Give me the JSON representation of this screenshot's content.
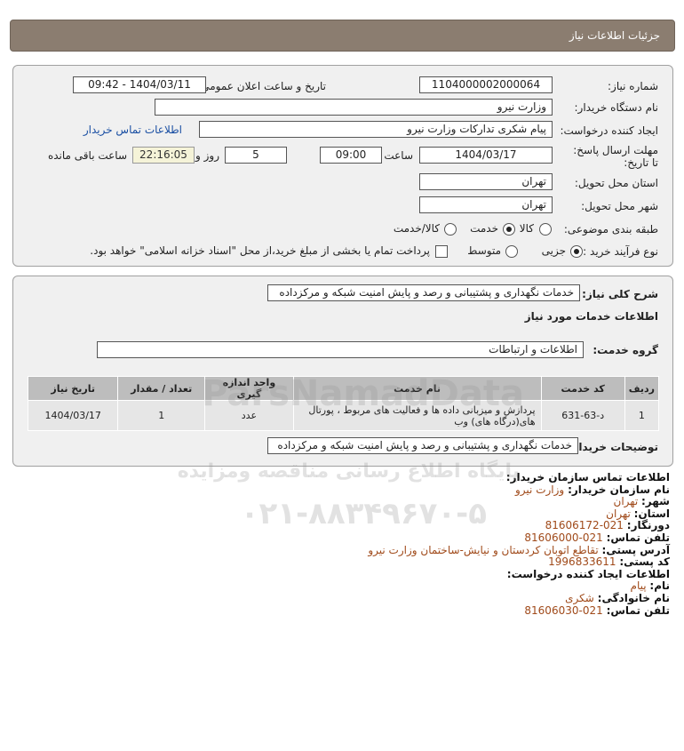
{
  "header": {
    "title": "جزئیات اطلاعات نیاز"
  },
  "form": {
    "need_number_label": "شماره نیاز:",
    "need_number": "1104000002000064",
    "announce_label": "تاریخ و ساعت اعلان عمومی:",
    "announce_value": "1404/03/11 - 09:42",
    "buyer_label": "نام دستگاه خریدار:",
    "buyer_value": "وزارت نیرو",
    "creator_label": "ایجاد کننده درخواست:",
    "creator_value": "پیام شکری تدارکات وزارت نیرو",
    "contact_link": "اطلاعات تماس خریدار",
    "deadline_label": "مهلت ارسال پاسخ: تا تاریخ:",
    "deadline_date": "1404/03/17",
    "hour_label": "ساعت",
    "deadline_hour": "09:00",
    "days_value": "5",
    "days_label": "روز و",
    "remaining_time": "22:16:05",
    "remaining_label": "ساعت باقی مانده",
    "province_label": "استان محل تحویل:",
    "province_value": "تهران",
    "city_label": "شهر محل تحویل:",
    "city_value": "تهران",
    "category_label": "طبقه بندی موضوعی:",
    "category_options": [
      "کالا",
      "خدمت",
      "کالا/خدمت"
    ],
    "category_selected": "خدمت",
    "process_label": "نوع فرآیند خرید :",
    "process_options": [
      "جزیی",
      "متوسط"
    ],
    "process_selected": "جزیی",
    "payment_note": "پرداخت تمام یا بخشی از مبلغ خرید،از محل \"اسناد خزانه اسلامی\" خواهد بود."
  },
  "need": {
    "summary_label": "شرح کلی نیاز:",
    "summary_value": "خدمات نگهداری و پشتیبانی و رصد و پایش امنیت شبکه و مرکزداده",
    "services_heading": "اطلاعات خدمات مورد نیاز",
    "group_label": "گروه خدمت:",
    "group_value": "اطلاعات و ارتباطات",
    "table": {
      "headers": [
        "ردیف",
        "کد خدمت",
        "نام خدمت",
        "واحد اندازه گیری",
        "تعداد / مقدار",
        "تاریخ نیاز"
      ],
      "rows": [
        [
          "1",
          "د-63-631",
          "پردازش و میزبانی داده ها و فعالیت های مربوط ، پورتال های(درگاه های) وب",
          "عدد",
          "1",
          "1404/03/17"
        ]
      ]
    },
    "description_label": "توضیحات خریدار:",
    "description_value": "خدمات نگهداری و پشتیبانی و رصد و پایش امنیت شبکه و مرکزداده"
  },
  "contact": {
    "heading": "اطلاعات تماس سازمان خریدار:",
    "org_label": "نام سازمان خریدار:",
    "org_value": "وزارت نیرو",
    "city_label": "شهر:",
    "city_value": "تهران",
    "province_label": "استان:",
    "province_value": "تهران",
    "fax_label": "دورنگار:",
    "fax_value": "021-81606172",
    "phone_label": "تلفن تماس:",
    "phone_value": "021-81606000",
    "address_label": "آدرس پستی:",
    "address_value": "تقاطع اتوبان کردستان و نیایش-ساختمان وزارت نیرو",
    "postal_label": "کد پستی:",
    "postal_value": "1996833611",
    "creator_heading": "اطلاعات ایجاد کننده درخواست:",
    "name_label": "نام:",
    "name_value": "پیام",
    "family_label": "نام خانوادگی:",
    "family_value": "شکری",
    "creator_phone_label": "تلفن تماس:",
    "creator_phone_value": "021-81606030"
  },
  "watermark": {
    "brand": "ParsNamadData",
    "line1": "پایگاه اطلاع رسانی مناقصه ومزایده",
    "line2": "۰۲۱-۸۸۳۴۹۶۷۰-۵"
  }
}
